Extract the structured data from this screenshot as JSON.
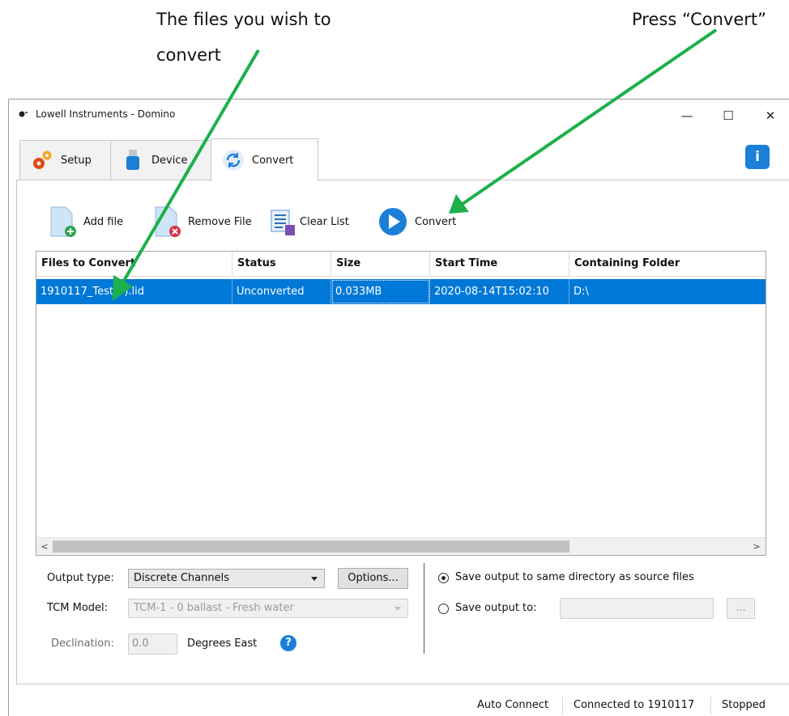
{
  "callouts": {
    "left_line1": "The files you wish to",
    "left_line2": "convert",
    "right": "Press “Convert”"
  },
  "window": {
    "title": "Lowell Instruments - Domino",
    "minimize": "—",
    "maximize": "☐",
    "close": "✕"
  },
  "tabs": [
    {
      "label": "Setup",
      "icon": "gears-icon"
    },
    {
      "label": "Device",
      "icon": "usb-drive-icon"
    },
    {
      "label": "Convert",
      "icon": "refresh-icon",
      "active": true
    }
  ],
  "info_button": "i",
  "toolbar": {
    "add_file": "Add file",
    "remove_file": "Remove File",
    "clear_list": "Clear List",
    "convert": "Convert"
  },
  "table": {
    "columns": [
      "Files to Convert",
      "Status",
      "Size",
      "Start Time",
      "Containing Folder"
    ],
    "rows": [
      {
        "file": "1910117_Test(0).lid",
        "status": "Unconverted",
        "size": "0.033MB",
        "start_time": "2020-08-14T15:02:10",
        "folder": "D:\\"
      }
    ],
    "scroll_left": "<",
    "scroll_right": ">"
  },
  "options": {
    "output_type_label": "Output type:",
    "output_type_value": "Discrete Channels",
    "options_button": "Options...",
    "tcm_model_label": "TCM Model:",
    "tcm_model_value": "TCM-1 - 0 ballast - Fresh water",
    "declination_label": "Declination:",
    "declination_value": "0.0",
    "declination_unit": "Degrees East",
    "help": "?",
    "save_same_dir": "Save output to same directory as source files",
    "save_to": "Save output to:",
    "browse_button": "..."
  },
  "status_bar": {
    "auto_connect": "Auto Connect",
    "connected": "Connected to 1910117",
    "state": "Stopped"
  },
  "colors": {
    "selection": "#0078d7",
    "accent": "#1b7fd8",
    "annotation_arrow": "#1db04b"
  }
}
